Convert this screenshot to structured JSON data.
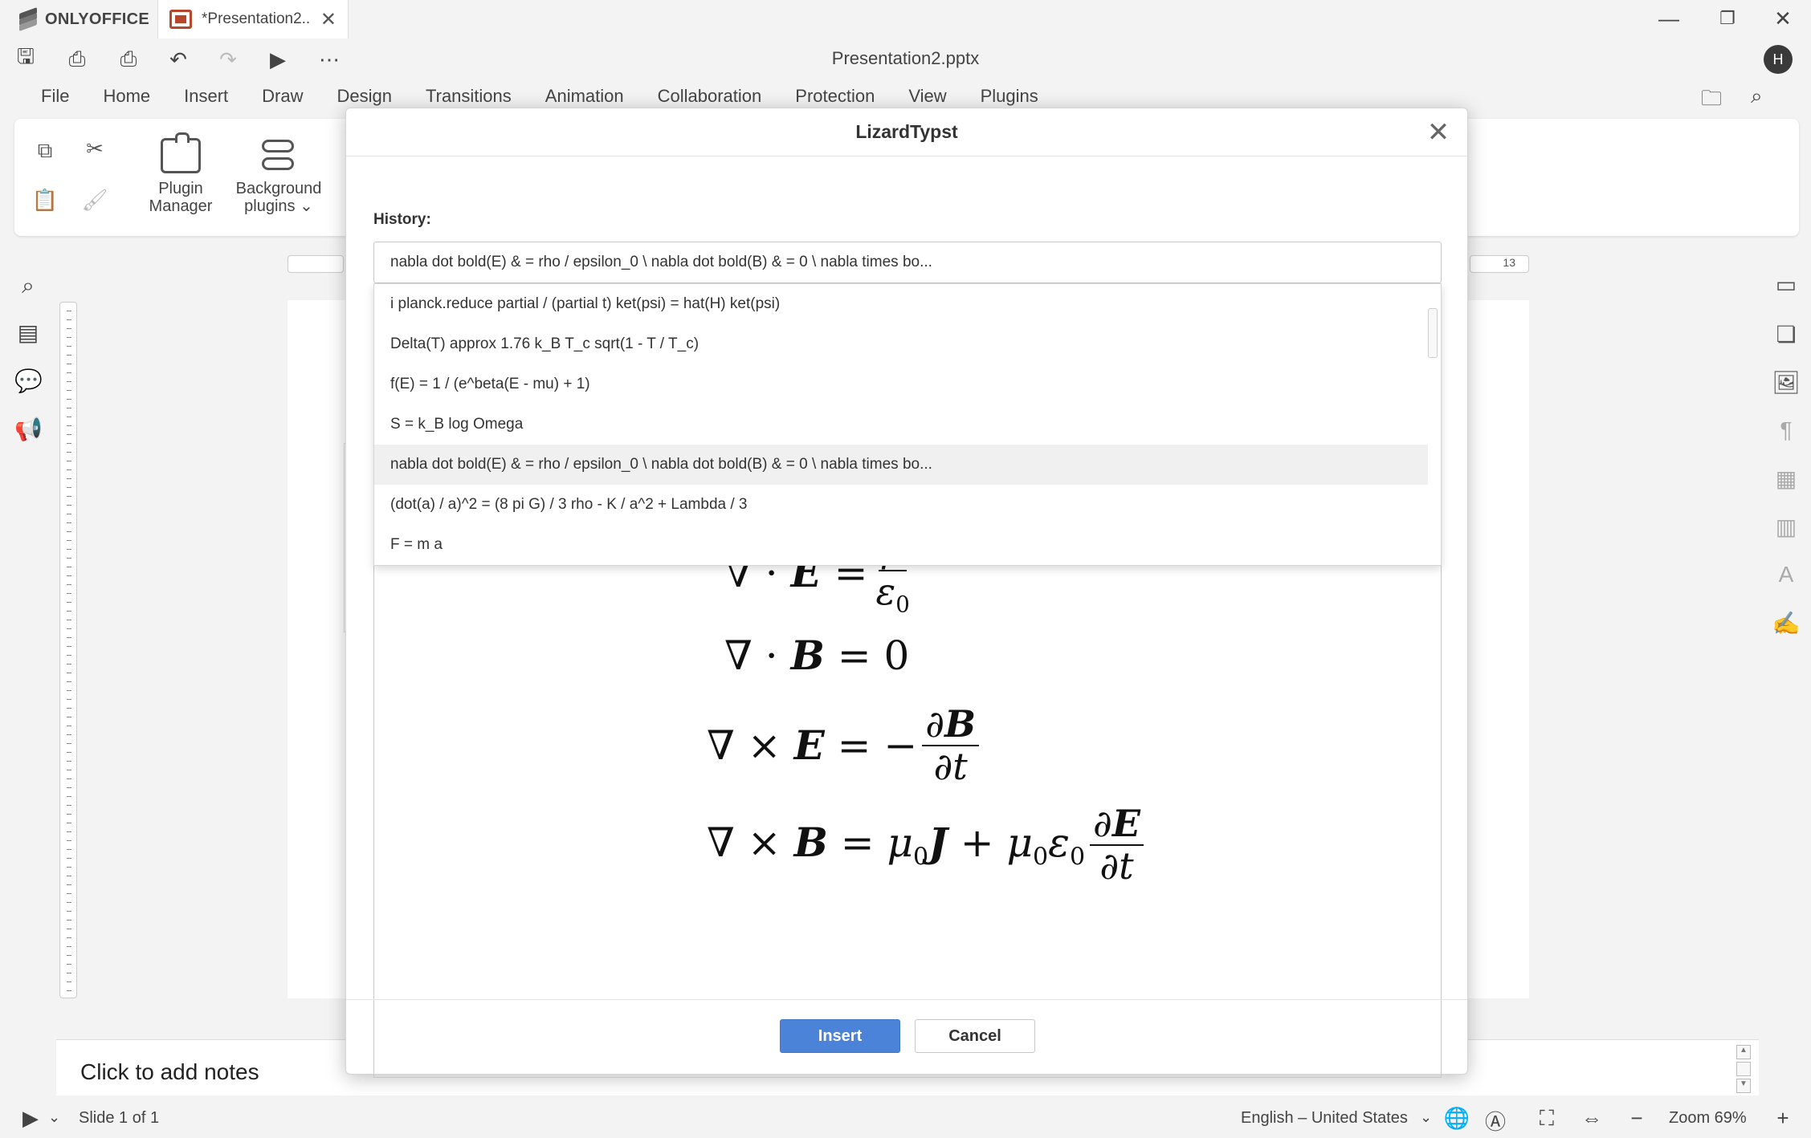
{
  "app": {
    "brand": "ONLYOFFICE",
    "tab_title": "*Presentation2...",
    "doc_title": "Presentation2.pptx",
    "avatar_initial": "H"
  },
  "menu": [
    "File",
    "Home",
    "Insert",
    "Draw",
    "Design",
    "Transitions",
    "Animation",
    "Collaboration",
    "Protection",
    "View",
    "Plugins"
  ],
  "ribbon": {
    "plugin_manager_label_1": "Plugin",
    "plugin_manager_label_2": "Manager",
    "background_plugins_label_1": "Background",
    "background_plugins_label_2": "plugins ⌄"
  },
  "ruler": {
    "right_label": "13"
  },
  "notes": {
    "placeholder": "Click to add notes"
  },
  "status": {
    "slide_info": "Slide 1 of 1",
    "language": "English – United States",
    "zoom": "Zoom 69%"
  },
  "dialog": {
    "title": "LizardTypst",
    "history_label": "History:",
    "selected_value": "nabla dot bold(E) & = rho / epsilon_0 \\ nabla dot bold(B) & = 0 \\ nabla times bo...",
    "history_items": [
      "i planck.reduce partial / (partial t) ket(psi) = hat(H) ket(psi)",
      "Delta(T) approx 1.76 k_B T_c sqrt(1 - T / T_c)",
      "f(E) = 1 / (e^beta(E - mu) + 1)",
      "S = k_B log Omega",
      "nabla dot bold(E) & = rho / epsilon_0 \\ nabla dot bold(B) & = 0 \\ nabla times bo...",
      "(dot(a) / a)^2 = (8 pi G) / 3 rho - K / a^2 + Lambda / 3",
      "F = m a"
    ],
    "insert_label": "Insert",
    "cancel_label": "Cancel"
  },
  "icons": {
    "save": "save-icon",
    "print": "print-icon",
    "quick_print": "quick-print-icon",
    "undo": "undo-icon",
    "redo": "redo-icon",
    "slideshow": "slideshow-icon",
    "more": "more-icon"
  },
  "colors": {
    "accent": "#4a83d8",
    "tab_icon": "#b7472a"
  }
}
